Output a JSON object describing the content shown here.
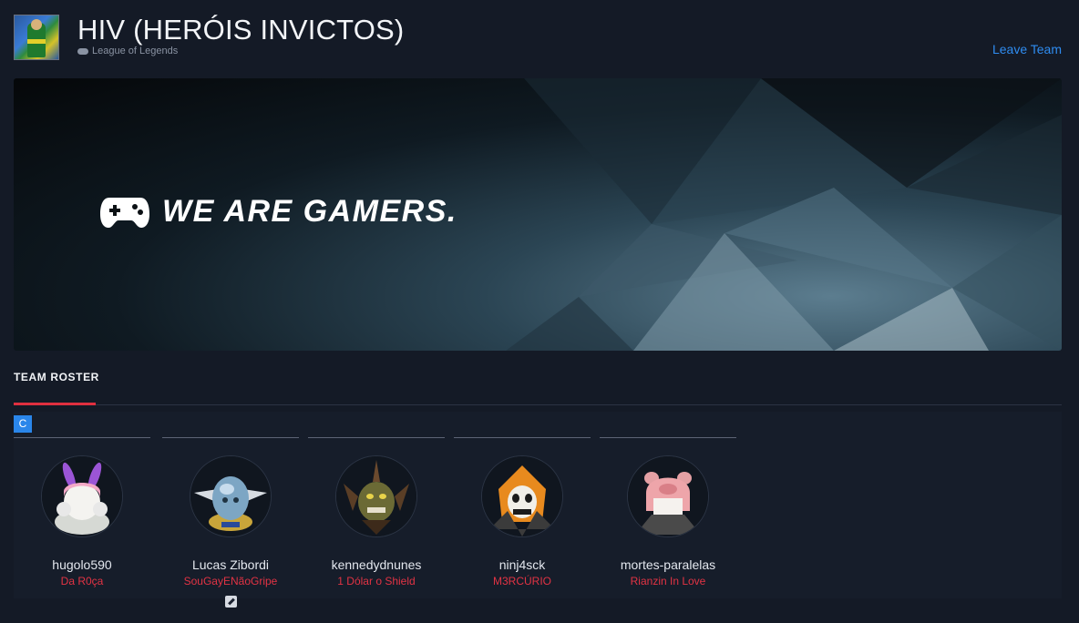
{
  "team": {
    "name": "HIV (HERÓIS INVICTOS)",
    "game": "League of Legends",
    "leave_label": "Leave Team"
  },
  "banner": {
    "tagline": "WE ARE GAMERS."
  },
  "roster": {
    "title": "TEAM ROSTER",
    "captain_badge": "C",
    "members": [
      {
        "username": "hugolo590",
        "nickname": "Da R0ça",
        "avatar": "bunny-ears-avatar"
      },
      {
        "username": "Lucas Zibordi",
        "nickname": "SouGayENãoGripe",
        "avatar": "blue-orb-warrior-avatar"
      },
      {
        "username": "kennedydnunes",
        "nickname": "1 Dólar o Shield",
        "avatar": "spiked-helmet-avatar"
      },
      {
        "username": "ninj4sck",
        "nickname": "M3RCÚRIO",
        "avatar": "hooded-skull-avatar"
      },
      {
        "username": "mortes-paralelas",
        "nickname": "Rianzin In Love",
        "avatar": "pig-hood-avatar"
      }
    ]
  },
  "colors": {
    "background": "#141a26",
    "accent_link": "#2f8cf0",
    "tab_underline": "#e0303f",
    "nickname": "#e23344",
    "captain_badge": "#2a86ea"
  }
}
